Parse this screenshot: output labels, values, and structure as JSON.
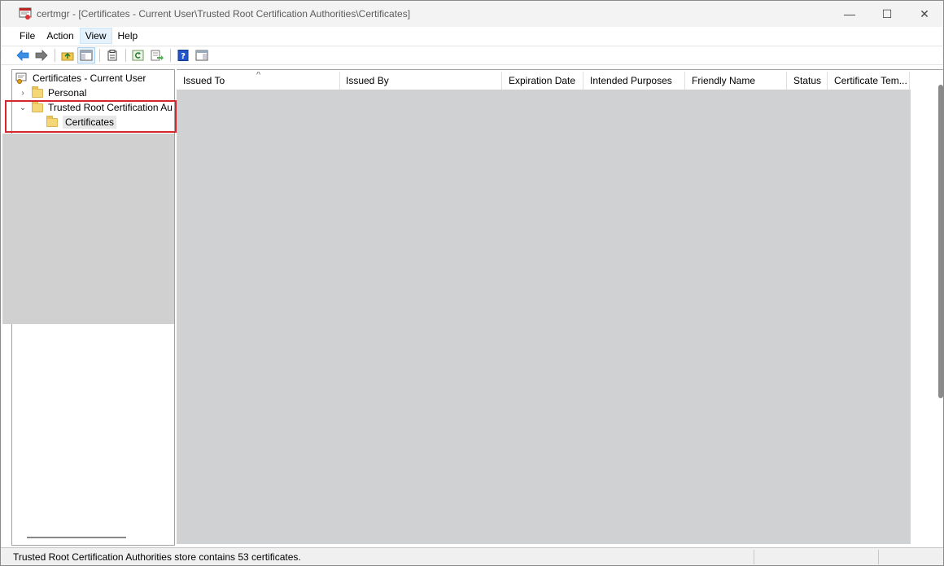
{
  "window": {
    "title": "certmgr - [Certificates - Current User\\Trusted Root Certification Authorities\\Certificates]",
    "controls": {
      "minimize": "—",
      "maximize": "☐",
      "close": "✕"
    }
  },
  "menu": {
    "items": [
      {
        "label": "File",
        "active": false
      },
      {
        "label": "Action",
        "active": false
      },
      {
        "label": "View",
        "active": true
      },
      {
        "label": "Help",
        "active": false
      }
    ]
  },
  "toolbar": {
    "buttons": [
      "back-arrow-icon",
      "forward-arrow-icon",
      "up-folder-icon",
      "show-hide-console-tree-icon",
      "properties-icon",
      "refresh-icon",
      "export-list-icon",
      "help-icon",
      "action-pane-icon"
    ]
  },
  "tree": {
    "root": "Certificates - Current User",
    "items": [
      {
        "label": "Personal",
        "expander": "›"
      },
      {
        "label": "Trusted Root Certification Au",
        "expander": "⌄"
      },
      {
        "label": "Certificates"
      }
    ]
  },
  "list": {
    "sort_indicator": "^",
    "columns": [
      "Issued To",
      "Issued By",
      "Expiration Date",
      "Intended Purposes",
      "Friendly Name",
      "Status",
      "Certificate Tem..."
    ]
  },
  "status": {
    "text": "Trusted Root Certification Authorities store contains 53 certificates."
  },
  "colors": {
    "highlight": "#d9262c",
    "redacted_gray": "#d0d1d3"
  }
}
